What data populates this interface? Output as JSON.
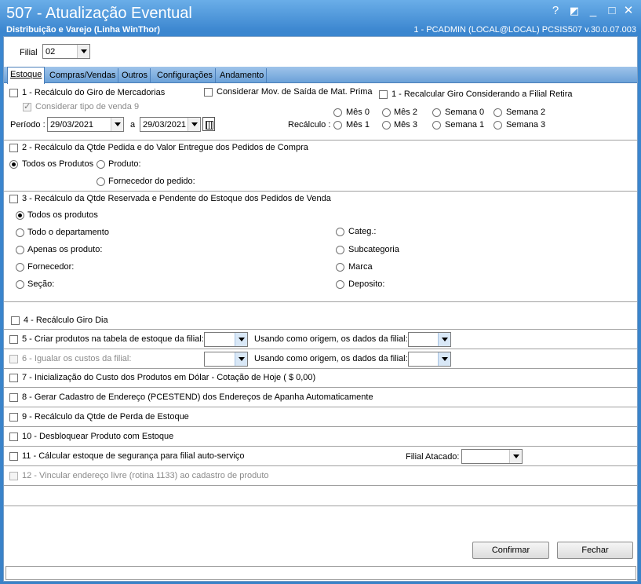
{
  "window": {
    "title": "507 - Atualização Eventual",
    "subtitle": "Distribuição e Varejo (Linha WinThor)",
    "connection": "1 - PCADMIN (LOCAL@LOCAL)   PCSIS507  v.30.0.07.003",
    "help_icon": "?",
    "restore_icon": "◩",
    "minimize_icon": "_",
    "maximize_icon": "□",
    "close_icon": "✕"
  },
  "filial": {
    "label": "Filial",
    "value": "02"
  },
  "tabs": [
    "Estoque",
    "Compras/Vendas",
    "Outros",
    "Configurações",
    "Andamento"
  ],
  "section1": {
    "check_giro": "1 - Recálculo do Giro de Mercadorias",
    "check_mat_prima": "Considerar Mov. de Saída de Mat. Prima",
    "check_filial_retira": "1 - Recalcular Giro Considerando a Filial Retira",
    "check_tipo_venda": "Considerar tipo de venda 9",
    "periodo_label": "Período :",
    "date_from": "29/03/2021",
    "a_label": "a",
    "date_to": "29/03/2021",
    "recalculo_label": "Recálculo :",
    "radios": [
      "Mês 0",
      "Mês 2",
      "Semana 0",
      "Semana 2",
      "Mês 1",
      "Mês 3",
      "Semana 1",
      "Semana 3"
    ]
  },
  "section2": {
    "check": "2 - Recálculo da Qtde Pedida e do Valor Entregue dos Pedidos de Compra",
    "radio_todos": "Todos os Produtos",
    "radio_produto": "Produto:",
    "radio_fornecedor": "Fornecedor do pedido:"
  },
  "section3": {
    "check": "3 - Recálculo da Qtde Reservada e Pendente do Estoque dos Pedidos de Venda",
    "left": [
      "Todos os produtos",
      "Todo o departamento",
      "Apenas os produto:",
      "Fornecedor:",
      "Seção:"
    ],
    "right": [
      "Categ.:",
      "Subcategoria",
      "Marca",
      "Deposito:"
    ]
  },
  "items": {
    "i4": "4 - Recálculo Giro Dia",
    "i5": "5 - Criar produtos na tabela de estoque da filial:",
    "i5_origem": "Usando como origem, os dados da filial:",
    "i6": "6 - Igualar os custos da filial:",
    "i6_origem": "Usando como origem, os dados da filial:",
    "i7": "7 - Inicialização do Custo dos Produtos em Dólar - Cotação de Hoje  ( $ 0,00)",
    "i8": "8 - Gerar Cadastro de Endereço (PCESTEND) dos Endereços de Apanha Automaticamente",
    "i9": "9 - Recálculo da Qtde de Perda de Estoque",
    "i10": "10 - Desbloquear Produto com Estoque",
    "i11": "11 - Cálcular estoque de segurança para filial auto-serviço",
    "i11_atacado": "Filial Atacado:",
    "i12": "12 - Vincular endereço livre (rotina 1133) ao cadastro de produto"
  },
  "buttons": {
    "confirmar": "Confirmar",
    "fechar": "Fechar"
  }
}
